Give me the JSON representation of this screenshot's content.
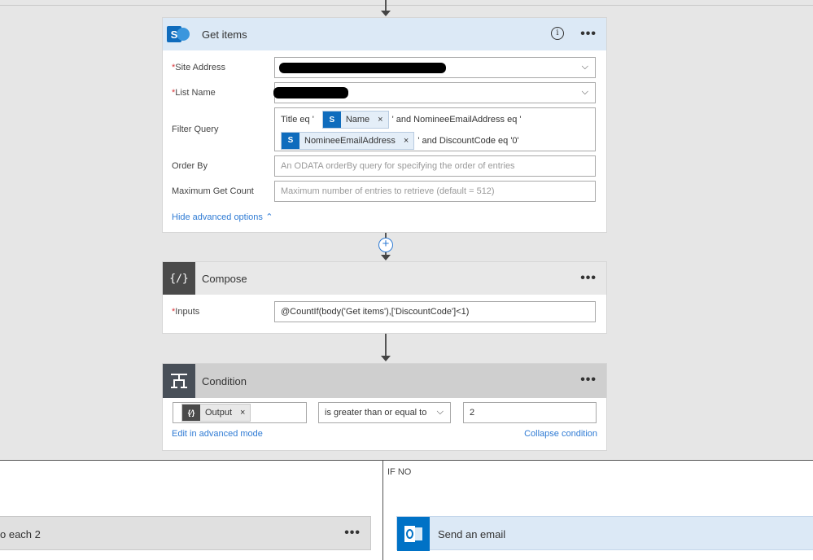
{
  "get_items": {
    "title": "Get items",
    "site_address_label": "Site Address",
    "list_name_label": "List Name",
    "filter_query_label": "Filter Query",
    "filter_text_1": "Title eq '",
    "token_name": "Name",
    "filter_text_2": "' and NomineeEmailAddress eq '",
    "token_email": "NomineeEmailAddress",
    "filter_text_3": "' and DiscountCode eq '0'",
    "order_by_label": "Order By",
    "order_by_placeholder": "An ODATA orderBy query for specifying the order of entries",
    "max_count_label": "Maximum Get Count",
    "max_count_placeholder": "Maximum number of entries to retrieve (default = 512)",
    "hide_advanced": "Hide advanced options"
  },
  "compose": {
    "title": "Compose",
    "inputs_label": "Inputs",
    "inputs_value": "@CountIf(body('Get items'),['DiscountCode']<1)"
  },
  "condition": {
    "title": "Condition",
    "token_output": "Output",
    "operator": "is greater than or equal to",
    "value": "2",
    "edit_advanced": "Edit in advanced mode",
    "collapse": "Collapse condition"
  },
  "branches": {
    "if_no": "IF NO",
    "left_action": "o each 2",
    "right_action": "Send an email"
  },
  "colors": {
    "sharepoint_blue": "#0f6cbd",
    "header_blue": "#dce9f6",
    "compose_dark": "#4a4a4a",
    "condition_grey": "#484f58",
    "outlook_blue": "#0072c6",
    "link_blue": "#2f7bd4",
    "required_red": "#d9373b"
  },
  "icons": {
    "get_items": "sharepoint-icon",
    "compose": "compose-braces-icon",
    "condition": "condition-icon",
    "email": "outlook-icon"
  }
}
